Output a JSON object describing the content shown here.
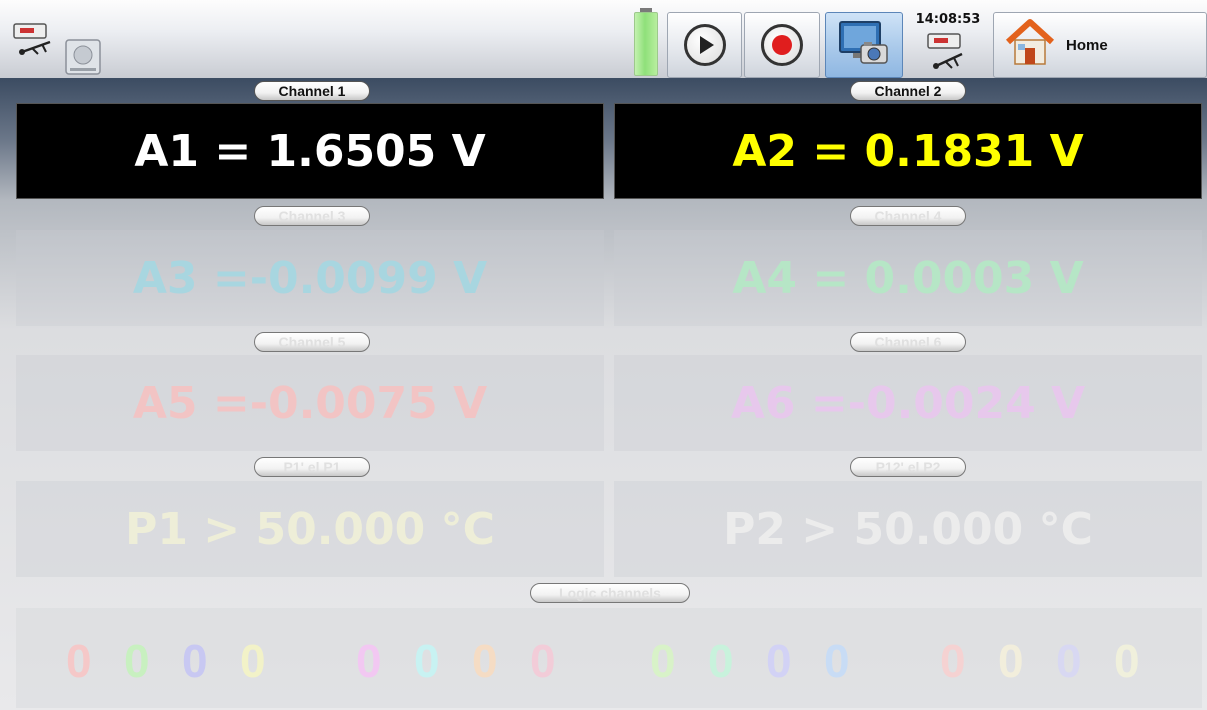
{
  "toolbar": {
    "time": "14:08:53",
    "home_label": "Home"
  },
  "icons": [
    "usb-icon",
    "disk-icon",
    "battery-icon",
    "play-icon",
    "record-icon",
    "screenshot-icon",
    "usb-icon",
    "home-icon"
  ],
  "channels": [
    {
      "label": "Channel 1",
      "reading": "A1 = 1.6505 V",
      "color": "#ffffff",
      "active": true
    },
    {
      "label": "Channel 2",
      "reading": "A2 = 0.1831 V",
      "color": "#ffff00",
      "active": true
    },
    {
      "label": "Channel 3",
      "reading": "A3 =-0.0099 V",
      "color": "#a8d6e0",
      "active": false
    },
    {
      "label": "Channel 4",
      "reading": "A4 = 0.0003 V",
      "color": "#b6e6c6",
      "active": false
    },
    {
      "label": "Channel 5",
      "reading": "A5 =-0.0075 V",
      "color": "#f2c4c4",
      "active": false
    },
    {
      "label": "Channel 6",
      "reading": "A6 =-0.0024 V",
      "color": "#e7c8ec",
      "active": false
    },
    {
      "label": "P1' el P1",
      "reading": "P1 > 50.000 °C",
      "color": "#eeeed8",
      "active": false
    },
    {
      "label": "P12' el P2",
      "reading": "P2 > 50.000 °C",
      "color": "#ececec",
      "active": false
    }
  ],
  "logic": {
    "label": "Logic channels",
    "digits": [
      {
        "value": "0",
        "color": "#f5c8c8"
      },
      {
        "value": "0",
        "color": "#c8f0c0"
      },
      {
        "value": "0",
        "color": "#c8c8f2"
      },
      {
        "value": "0",
        "color": "#f2f2c8"
      },
      {
        "value": "0",
        "color": "#f2c8f2"
      },
      {
        "value": "0",
        "color": "#c8f2f2"
      },
      {
        "value": "0",
        "color": "#f5dcc4"
      },
      {
        "value": "0",
        "color": "#f2ccd8"
      },
      {
        "value": "0",
        "color": "#d8f2c8"
      },
      {
        "value": "0",
        "color": "#c8f2dc"
      },
      {
        "value": "0",
        "color": "#d2d2f5"
      },
      {
        "value": "0",
        "color": "#c8dcf5"
      },
      {
        "value": "0",
        "color": "#f5d2d2"
      },
      {
        "value": "0",
        "color": "#f2eedc"
      },
      {
        "value": "0",
        "color": "#d8d8f2"
      },
      {
        "value": "0",
        "color": "#f0f0dc"
      }
    ]
  }
}
